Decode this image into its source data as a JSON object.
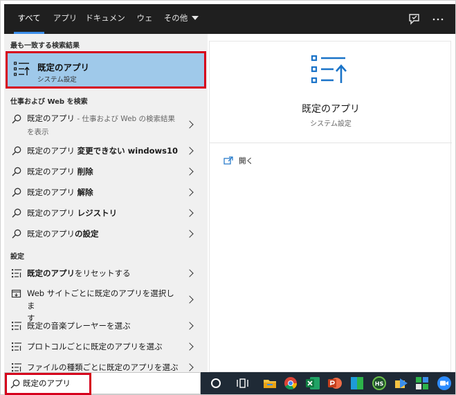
{
  "tabs": [
    {
      "label": "すべて",
      "active": true
    },
    {
      "label": "アプリ"
    },
    {
      "label": "ドキュメント"
    },
    {
      "label": "ウェブ"
    },
    {
      "label": "その他"
    }
  ],
  "top_icons": [
    "feedback-icon",
    "more-options-icon"
  ],
  "best_match": {
    "heading": "最も一致する検索結果",
    "title": "既定のアプリ",
    "subtitle": "システム設定",
    "icon": "default-apps-icon"
  },
  "web_section": {
    "heading": "仕事および Web を検索",
    "items": [
      {
        "pre": "既定のアプリ",
        "bold": "",
        "gray": " - 仕事および Web の検索結果",
        "tail": "を表示"
      },
      {
        "pre": "既定のアプリ ",
        "bold": "変更できない windows10",
        "gray": "",
        "tail": ""
      },
      {
        "pre": "既定のアプリ ",
        "bold": "削除",
        "gray": "",
        "tail": ""
      },
      {
        "pre": "既定のアプリ ",
        "bold": "解除",
        "gray": "",
        "tail": ""
      },
      {
        "pre": "既定のアプリ ",
        "bold": "レジストリ",
        "gray": "",
        "tail": ""
      },
      {
        "pre": "既定のアプリ",
        "bold": "の設定",
        "gray": "",
        "tail": ""
      }
    ]
  },
  "settings_section": {
    "heading": "設定",
    "items": [
      {
        "pre": "",
        "bold": "既定のアプリ",
        "post": "をリセットする",
        "post2": "",
        "icon": "list-settings-icon"
      },
      {
        "pre": "Web サイトごとに",
        "bold": "",
        "post": "既定のアプリを選択しま",
        "post2": "す",
        "icon": "web-app-icon"
      },
      {
        "pre": "既定の音楽プレーヤーを選ぶ",
        "bold": "",
        "post": "",
        "post2": "",
        "icon": "list-settings-icon"
      },
      {
        "pre": "プロトコルごとに",
        "bold": "",
        "post": "既定のアプリを選ぶ",
        "post2": "",
        "icon": "list-settings-icon"
      },
      {
        "pre": "ファイルの種類ごとに",
        "bold": "",
        "post": "既定のアプリを選ぶ",
        "post2": "",
        "icon": "list-settings-icon"
      }
    ]
  },
  "preview": {
    "title": "既定のアプリ",
    "subtitle": "システム設定",
    "open_label": "開く"
  },
  "search": {
    "value": "既定のアプリ",
    "placeholder": ""
  },
  "taskbar_icons": [
    "cortana-icon",
    "task-view-icon",
    "file-explorer-icon",
    "chrome-icon",
    "excel-icon",
    "powerpoint-icon",
    "app-tile-icon",
    "hs-app-icon",
    "send-icon",
    "puzzle-app-icon",
    "zoom-icon"
  ],
  "colors": {
    "accent": "#3b8eea",
    "highlight": "#d6001c",
    "selected": "#9fc9ea",
    "icon_blue": "#1a73c8"
  }
}
